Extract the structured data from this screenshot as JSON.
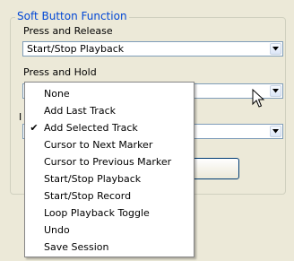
{
  "group": {
    "title": "Soft Button Function"
  },
  "press_release": {
    "label": "Press and Release",
    "value": "Start/Stop Playback"
  },
  "press_hold": {
    "label": "Press and Hold",
    "value": ""
  },
  "third": {
    "label_partial": "I",
    "value": ""
  },
  "menu": {
    "items": [
      {
        "label": "None",
        "checked": false
      },
      {
        "label": "Add Last Track",
        "checked": false
      },
      {
        "label": "Add Selected Track",
        "checked": true
      },
      {
        "label": "Cursor to Next Marker",
        "checked": false
      },
      {
        "label": "Cursor to Previous Marker",
        "checked": false
      },
      {
        "label": "Start/Stop Playback",
        "checked": false
      },
      {
        "label": "Start/Stop Record",
        "checked": false
      },
      {
        "label": "Loop Playback Toggle",
        "checked": false
      },
      {
        "label": "Undo",
        "checked": false
      },
      {
        "label": "Save Session",
        "checked": false
      }
    ],
    "check_glyph": "✔"
  },
  "icons": {
    "dropdown": "chevron-down-icon",
    "cursor": "mouse-pointer-icon"
  },
  "colors": {
    "legend": "#0046d5",
    "combo_border": "#7f9db9",
    "background": "#ece9d8"
  }
}
